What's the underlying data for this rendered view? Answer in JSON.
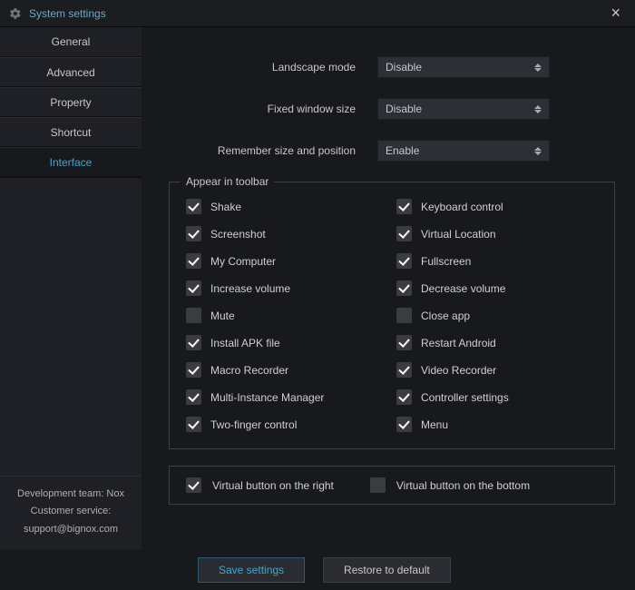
{
  "window": {
    "title": "System settings",
    "close_icon": "close"
  },
  "sidebar": {
    "tabs": [
      {
        "label": "General",
        "active": false
      },
      {
        "label": "Advanced",
        "active": false
      },
      {
        "label": "Property",
        "active": false
      },
      {
        "label": "Shortcut",
        "active": false
      },
      {
        "label": "Interface",
        "active": true
      }
    ],
    "info": {
      "team": "Development team: Nox",
      "cs_label": "Customer service:",
      "cs_email": "support@bignox.com"
    }
  },
  "form": {
    "landscape_label": "Landscape mode",
    "landscape_value": "Disable",
    "fixed_label": "Fixed window size",
    "fixed_value": "Disable",
    "remember_label": "Remember size and position",
    "remember_value": "Enable"
  },
  "toolbar_section": {
    "legend": "Appear in toolbar",
    "items": [
      {
        "label": "Shake",
        "checked": true
      },
      {
        "label": "Keyboard control",
        "checked": true
      },
      {
        "label": "Screenshot",
        "checked": true
      },
      {
        "label": "Virtual Location",
        "checked": true
      },
      {
        "label": "My Computer",
        "checked": true
      },
      {
        "label": "Fullscreen",
        "checked": true
      },
      {
        "label": "Increase volume",
        "checked": true
      },
      {
        "label": "Decrease volume",
        "checked": true
      },
      {
        "label": "Mute",
        "checked": false
      },
      {
        "label": "Close app",
        "checked": false
      },
      {
        "label": "Install APK file",
        "checked": true
      },
      {
        "label": "Restart Android",
        "checked": true
      },
      {
        "label": "Macro Recorder",
        "checked": true
      },
      {
        "label": "Video Recorder",
        "checked": true
      },
      {
        "label": "Multi-Instance Manager",
        "checked": true
      },
      {
        "label": "Controller settings",
        "checked": true
      },
      {
        "label": "Two-finger control",
        "checked": true
      },
      {
        "label": "Menu",
        "checked": true
      }
    ],
    "virtual_right": {
      "label": "Virtual button on the right",
      "checked": true
    },
    "virtual_bottom": {
      "label": "Virtual button on the bottom",
      "checked": false
    }
  },
  "buttons": {
    "save": "Save settings",
    "restore": "Restore to default"
  }
}
